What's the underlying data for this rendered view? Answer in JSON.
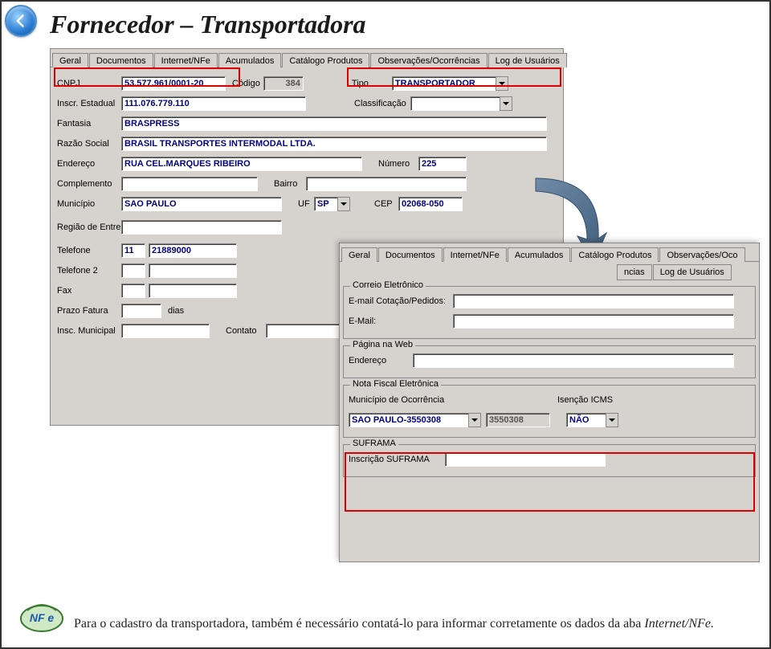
{
  "title": "Fornecedor – Transportadora",
  "footnote_pre": "Para o cadastro da transportadora, também é necessário contatá-lo para informar corretamente os dados da aba ",
  "footnote_em": "Internet/NFe.",
  "panel1": {
    "tabs": [
      "Geral",
      "Documentos",
      "Internet/NFe",
      "Acumulados",
      "Catálogo Produtos",
      "Observações/Ocorrências",
      "Log de Usuários"
    ],
    "active_tab": 0,
    "labels": {
      "cnpj": "CNPJ",
      "codigo": "Código",
      "tipo": "Tipo",
      "inscr_est": "Inscr. Estadual",
      "classificacao": "Classificação",
      "fantasia": "Fantasia",
      "razao": "Razão Social",
      "endereco": "Endereço",
      "numero": "Número",
      "complemento": "Complemento",
      "bairro": "Bairro",
      "municipio": "Município",
      "uf": "UF",
      "cep": "CEP",
      "regiao": "Região de Entrega",
      "telefone": "Telefone",
      "telefone2": "Telefone 2",
      "fax": "Fax",
      "prazo": "Prazo Fatura",
      "dias": "dias",
      "insc_mun": "Insc. Municipal",
      "contato": "Contato"
    },
    "values": {
      "cnpj": "53.577.961/0001-20",
      "codigo": "384",
      "tipo": "TRANSPORTADOR",
      "inscr_est": "111.076.779.110",
      "classificacao": "",
      "fantasia": "BRASPRESS",
      "razao": "BRASIL TRANSPORTES INTERMODAL LTDA.",
      "endereco": "RUA CEL.MARQUES RIBEIRO",
      "numero": "225",
      "complemento": "",
      "bairro": "",
      "municipio": "SAO PAULO",
      "uf": "SP",
      "cep": "02068-050",
      "regiao": "",
      "telefone_ddd": "11",
      "telefone_num": "21889000",
      "telefone2_ddd": "",
      "telefone2_num": "",
      "fax_ddd": "",
      "fax_num": "",
      "prazo": "",
      "insc_mun": "",
      "contato": ""
    }
  },
  "panel2": {
    "tabs": [
      "Geral",
      "Documentos",
      "Internet/NFe",
      "Acumulados",
      "Catálogo Produtos",
      "Observações/Ocorrências",
      "Log de Usuários"
    ],
    "tabs_render": [
      "Geral",
      "Documentos",
      "Internet/NFe",
      "Acumulados",
      "Catálogo Produtos",
      "Observações/Oco",
      "ncias",
      "Log de Usuários"
    ],
    "active_tab": 2,
    "groups": {
      "correio": {
        "title": "Correio Eletrônico",
        "labels": {
          "cot": "E-mail Cotação/Pedidos:",
          "email": "E-Mail:"
        },
        "values": {
          "cot": "",
          "email": ""
        }
      },
      "web": {
        "title": "Página na Web",
        "labels": {
          "endereco": "Endereço"
        },
        "values": {
          "endereco": ""
        }
      },
      "nfe": {
        "title": "Nota Fiscal Eletrônica",
        "labels": {
          "mun": "Município de Ocorrência",
          "isencao": "Isenção ICMS"
        },
        "values": {
          "mun_sel": "SAO PAULO-3550308",
          "mun_code": "3550308",
          "isencao": "NÃO"
        }
      },
      "suframa": {
        "title": "SUFRAMA",
        "labels": {
          "inscr": "Inscrição SUFRAMA"
        },
        "values": {
          "inscr": ""
        }
      }
    }
  }
}
